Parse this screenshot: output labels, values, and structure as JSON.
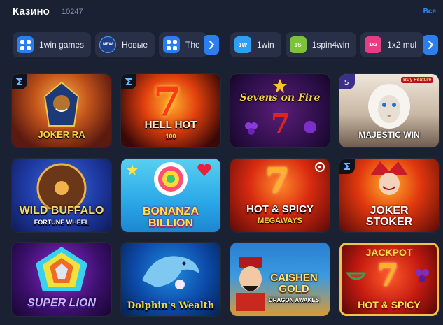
{
  "header": {
    "title": "Казино",
    "count": "10247",
    "all_label": "Все"
  },
  "chips_left": [
    {
      "icon": "grid-icon",
      "label": "1win games"
    },
    {
      "icon": "new-icon",
      "label": "Новые"
    },
    {
      "icon": "grid-icon",
      "label": "The"
    }
  ],
  "chips_right": [
    {
      "icon": "1win-icon",
      "label": "1win"
    },
    {
      "icon": "1spin4win-icon",
      "label": "1spin4win"
    },
    {
      "icon": "1x2-icon",
      "label": "1x2 mul"
    }
  ],
  "chip_icon_text": {
    "new": "NEW",
    "onewin": "1W",
    "spin": "1S",
    "x2": "1x2"
  },
  "games": [
    {
      "name": "JOKER RA",
      "subtitle": ""
    },
    {
      "name": "HELL HOT",
      "subtitle": "100"
    },
    {
      "name": "Sevens on Fire",
      "subtitle": ""
    },
    {
      "name": "MAJESTIC WIN",
      "subtitle": ""
    },
    {
      "name": "WILD BUFFALO",
      "subtitle": "FORTUNE WHEEL"
    },
    {
      "name": "BONANZA",
      "subtitle": "BILLION"
    },
    {
      "name": "HOT & SPICY",
      "subtitle": "MEGAWAYS"
    },
    {
      "name": "JOKER",
      "subtitle": "STOKER"
    },
    {
      "name": "SUPER LION",
      "subtitle": ""
    },
    {
      "name": "Dolphin's Wealth",
      "subtitle": ""
    },
    {
      "name": "CAISHEN GOLD",
      "subtitle": "DRAGON AWAKES"
    },
    {
      "name": "HOT & SPICY",
      "subtitle": ""
    }
  ],
  "tile_extras": {
    "buy_feature": "Buy Feature",
    "jackpot": "JACKPOT"
  },
  "colors": {
    "background": "#1a2133",
    "chip": "#273047",
    "accent": "#2b7ef0",
    "link": "#2f8ef0"
  }
}
